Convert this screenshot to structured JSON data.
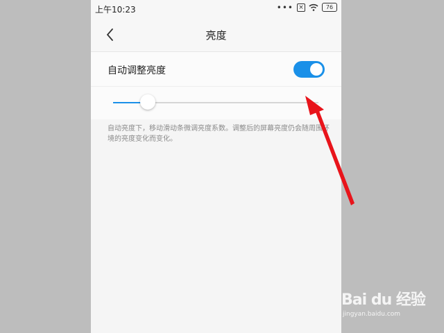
{
  "statusbar": {
    "time": "上午10:23",
    "dots": "•••",
    "battery": "76",
    "icons": [
      "more-dots-icon",
      "sim-x-icon",
      "wifi-icon",
      "battery-icon"
    ]
  },
  "header": {
    "title": "亮度",
    "back_icon": "chevron-left-icon"
  },
  "settings": {
    "auto_brightness_label": "自动调整亮度",
    "auto_brightness_on": true,
    "brightness_level": 0.17,
    "description": "自动亮度下，移动滑动条微调亮度系数。调整后的屏幕亮度仍会随周围环境的亮度变化而变化。"
  },
  "colors": {
    "accent": "#1a90e8",
    "annotation_arrow": "#e8141b"
  },
  "watermark": {
    "brand": "Bai du 经验",
    "url": "jingyan.baidu.com"
  }
}
